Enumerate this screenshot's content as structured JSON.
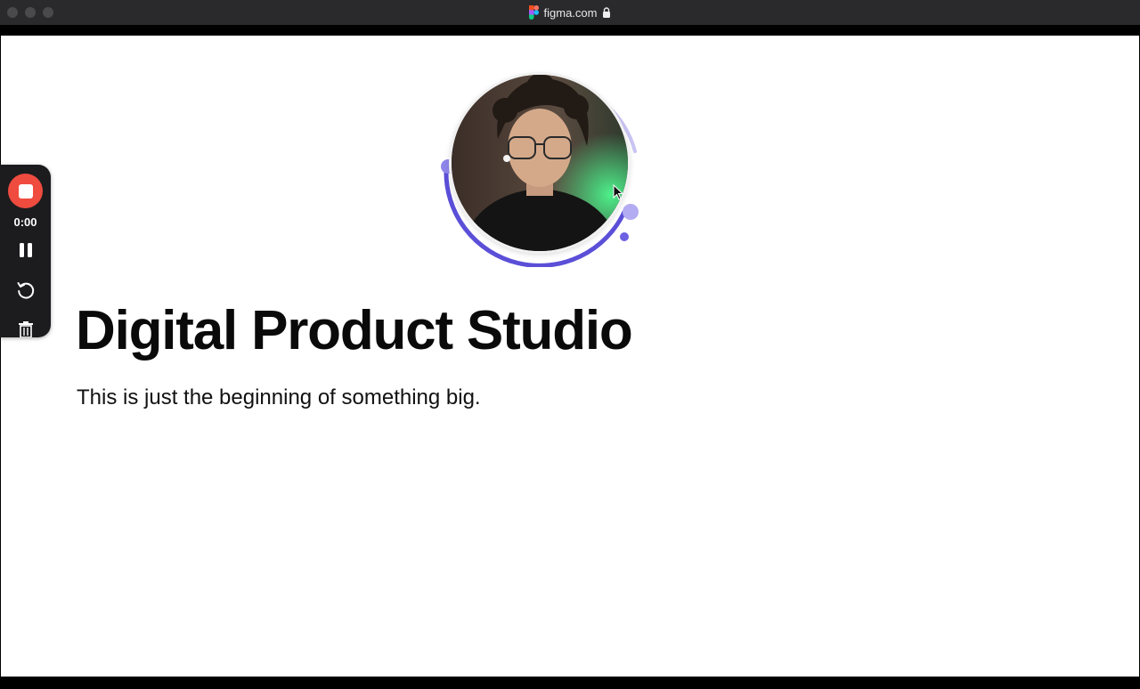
{
  "browser": {
    "url": "figma.com",
    "icons": {
      "site": "figma-logo",
      "secure": "lock-icon"
    }
  },
  "page": {
    "headline": "Digital Product Studio",
    "subtitle": "This is just the beginning of something big."
  },
  "recorder": {
    "timer": "0:00",
    "controls": [
      "stop-icon",
      "pause-icon",
      "restart-icon",
      "trash-icon"
    ],
    "stop_color": "#ef4b3f"
  },
  "avatar": {
    "ring_color": "#6b5fe0",
    "ring_light_color": "#b9b3f0"
  }
}
